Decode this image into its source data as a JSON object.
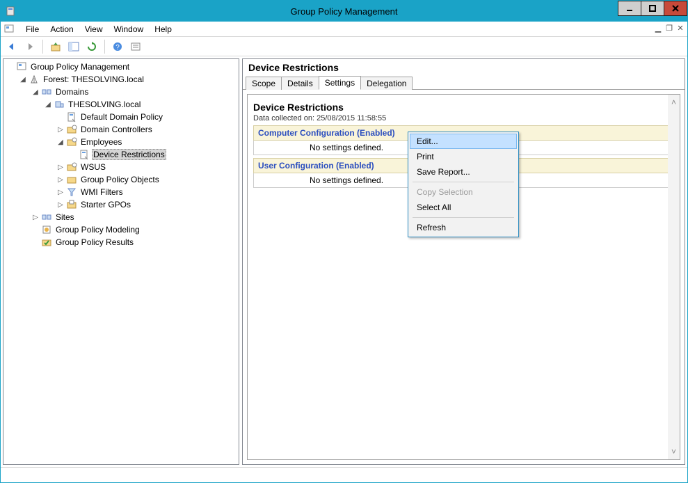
{
  "window": {
    "title": "Group Policy Management"
  },
  "menubar": {
    "file": "File",
    "action": "Action",
    "view": "View",
    "window": "Window",
    "help": "Help"
  },
  "tree": {
    "root": "Group Policy Management",
    "forest": "Forest: THESOLVING.local",
    "domains": "Domains",
    "domain1": "THESOLVING.local",
    "default_policy": "Default Domain Policy",
    "domain_controllers": "Domain Controllers",
    "employees": "Employees",
    "device_restrictions": "Device Restrictions",
    "wsus": "WSUS",
    "gpo": "Group Policy Objects",
    "wmi": "WMI Filters",
    "starter": "Starter GPOs",
    "sites": "Sites",
    "modeling": "Group Policy Modeling",
    "results": "Group Policy Results"
  },
  "right": {
    "header": "Device Restrictions",
    "tabs": {
      "scope": "Scope",
      "details": "Details",
      "settings": "Settings",
      "delegation": "Delegation"
    },
    "report": {
      "title": "Device Restrictions",
      "collected": "Data collected on: 25/08/2015 11:58:55",
      "comp_conf": "Computer Configuration (Enabled)",
      "comp_none": "No settings defined.",
      "user_conf": "User Configuration (Enabled)",
      "user_none": "No settings defined."
    }
  },
  "context_menu": {
    "edit": "Edit...",
    "print": "Print",
    "save_report": "Save Report...",
    "copy_selection": "Copy Selection",
    "select_all": "Select All",
    "refresh": "Refresh"
  }
}
